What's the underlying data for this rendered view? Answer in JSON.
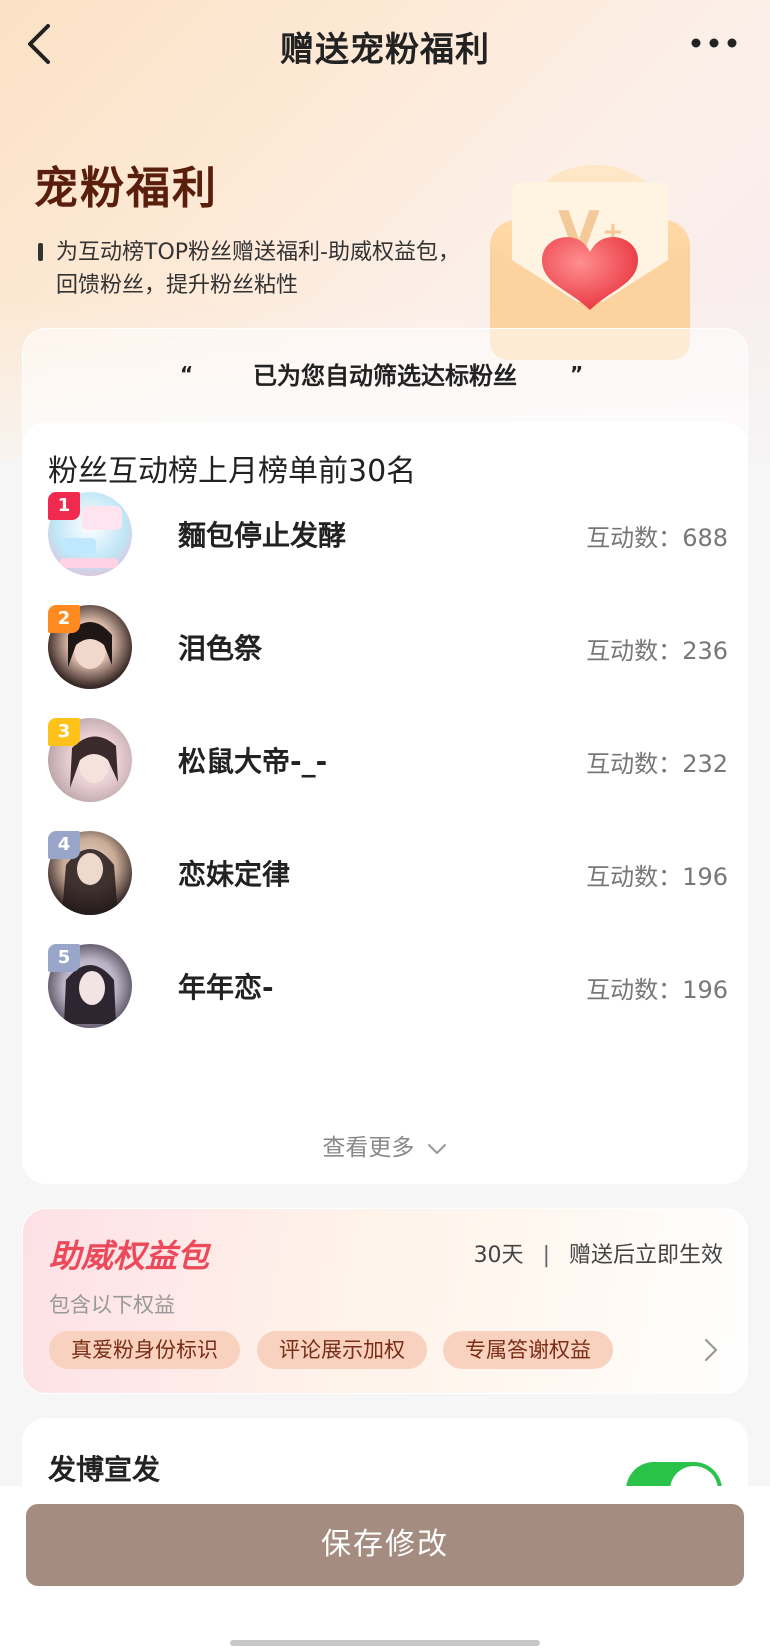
{
  "nav": {
    "title": "赠送宠粉福利"
  },
  "hero": {
    "title": "宠粉福利",
    "description": "为互动榜TOP粉丝赠送福利-助威权益包，回馈粉丝，提升粉丝粘性"
  },
  "filter": {
    "title": "已为您自动筛选达标粉丝",
    "quote_open": "“",
    "quote_close": "”"
  },
  "ranking": {
    "heading": "粉丝互动榜上月榜单前30名",
    "count_label": "互动数：",
    "fans": [
      {
        "rank": "1",
        "name": "麵包停止发酵",
        "count": "688",
        "badge_color": "#f0294f"
      },
      {
        "rank": "2",
        "name": "泪色祭",
        "count": "236",
        "badge_color": "#ff8a1f"
      },
      {
        "rank": "3",
        "name": "松鼠大帝-_-",
        "count": "232",
        "badge_color": "#ffc21a"
      },
      {
        "rank": "4",
        "name": "恋妹定律",
        "count": "196",
        "badge_color": "#9aa6c9"
      },
      {
        "rank": "5",
        "name": "年年恋-",
        "count": "196",
        "badge_color": "#9aa6c9"
      }
    ],
    "see_more": "查看更多"
  },
  "benefit": {
    "title": "助威权益包",
    "duration": "30天",
    "separator": "|",
    "effect": "赠送后立即生效",
    "subtitle": "包含以下权益",
    "tags": [
      "真爱粉身份标识",
      "评论展示加权",
      "专属答谢权益"
    ]
  },
  "post": {
    "title": "发博宣发",
    "toggle_on": true
  },
  "actions": {
    "save_label": "保存修改"
  },
  "colors": {
    "accent_red": "#ec4a5a",
    "toggle_green": "#2ac34a",
    "save_button": "#a48d80"
  }
}
